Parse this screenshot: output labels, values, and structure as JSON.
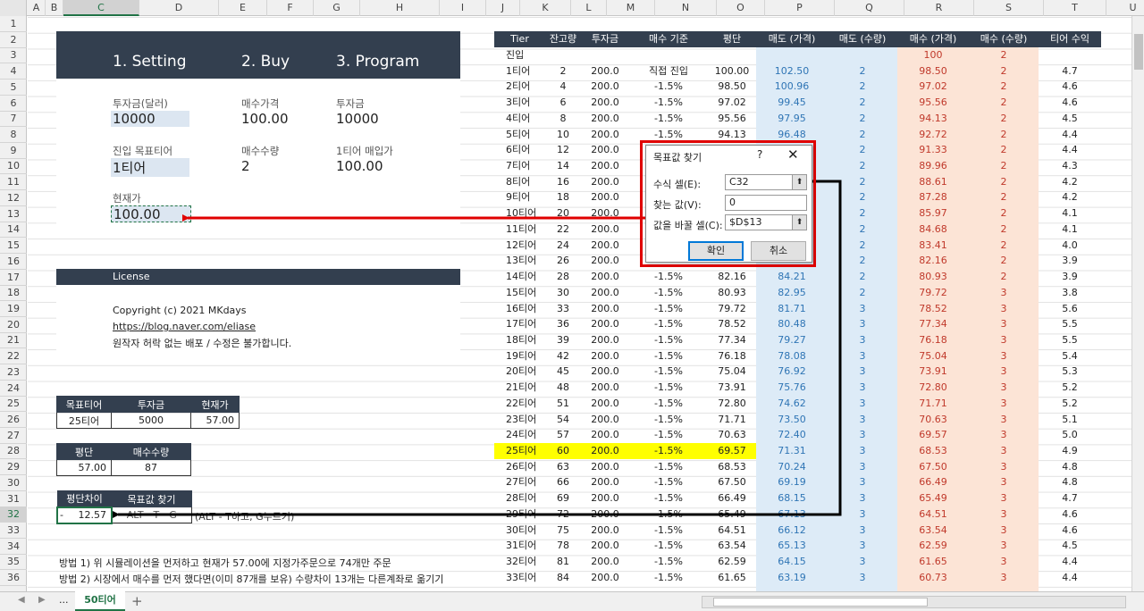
{
  "columns": [
    "A",
    "B",
    "C",
    "D",
    "E",
    "F",
    "G",
    "H",
    "I",
    "J",
    "K",
    "L",
    "M",
    "N",
    "O",
    "P",
    "Q",
    "R",
    "S",
    "T",
    "U"
  ],
  "selected_column": "C",
  "rows": [
    "1",
    "2",
    "3",
    "4",
    "5",
    "6",
    "7",
    "8",
    "9",
    "10",
    "11",
    "12",
    "13",
    "14",
    "15",
    "16",
    "17",
    "18",
    "19",
    "20",
    "21",
    "22",
    "23",
    "24",
    "25",
    "26",
    "27",
    "28",
    "29",
    "30",
    "31",
    "32",
    "33",
    "34",
    "35",
    "36"
  ],
  "selected_row": "32",
  "menu": {
    "setting": "1. Setting",
    "buy": "2. Buy",
    "program": "3. Program"
  },
  "settings": {
    "invest_label": "투자금(달러)",
    "invest_value": "10000",
    "buy_price_label": "매수가격",
    "buy_price_value": "100.00",
    "invest2_label": "투자금",
    "invest2_value": "10000",
    "target_tier_label": "진입 목표티어",
    "target_tier_value": "1티어",
    "buy_qty_label": "매수수량",
    "buy_qty_value": "2",
    "tier1_cost_label": "1티어 매입가",
    "tier1_cost_value": "100.00",
    "current_price_label": "현재가",
    "current_price_value": "100.00"
  },
  "license": {
    "title": "License",
    "copyright": "Copyright (c) 2021 MKdays",
    "link": "https://blog.naver.com/eliase",
    "notice": "원작자 허락 없는 배포 / 수정은 불가합니다."
  },
  "table1": {
    "h1": "목표티어",
    "h2": "투자금",
    "h3": "현재가",
    "v1": "25티어",
    "v2": "5000",
    "v3": "57.00"
  },
  "table2": {
    "h1": "평단",
    "h2": "매수수량",
    "v1": "57.00",
    "v2": "87"
  },
  "table3": {
    "h1": "평단차이",
    "h2": "목표값 찾기",
    "v1_prefix": "-",
    "v1": "12.57",
    "v2": "ALT - T - G",
    "hint": "(ALT - T하고, G누르기)"
  },
  "methods": {
    "m1": "방법 1) 위 시뮬레이션을 먼저하고 현재가 57.00에 지정가주문으로 74개만 주문",
    "m2": "방법 2) 시장에서 매수를 먼저 했다면(이미 87개를 보유) 수량차이 13개는 다른계좌로 옮기기"
  },
  "right_headers": [
    "Tier",
    "잔고량",
    "투자금",
    "매수 기준",
    "평단",
    "매도 (가격)",
    "매도 (수량)",
    "매수 (가격)",
    "매수 (수량)",
    "티어 수익"
  ],
  "entry_row": {
    "tier": "진입",
    "buy_price": "100",
    "buy_qty": "2"
  },
  "right_rows": [
    [
      "1티어",
      "2",
      "200.0",
      "직접 진입",
      "100.00",
      "102.50",
      "2",
      "98.50",
      "2",
      "4.7"
    ],
    [
      "2티어",
      "4",
      "200.0",
      "-1.5%",
      "98.50",
      "100.96",
      "2",
      "97.02",
      "2",
      "4.6"
    ],
    [
      "3티어",
      "6",
      "200.0",
      "-1.5%",
      "97.02",
      "99.45",
      "2",
      "95.56",
      "2",
      "4.6"
    ],
    [
      "4티어",
      "8",
      "200.0",
      "-1.5%",
      "95.56",
      "97.95",
      "2",
      "94.13",
      "2",
      "4.5"
    ],
    [
      "5티어",
      "10",
      "200.0",
      "-1.5%",
      "94.13",
      "96.48",
      "2",
      "92.72",
      "2",
      "4.4"
    ],
    [
      "6티어",
      "12",
      "200.0",
      "",
      "",
      "",
      "2",
      "91.33",
      "2",
      "4.4"
    ],
    [
      "7티어",
      "14",
      "200.0",
      "",
      "",
      "",
      "2",
      "89.96",
      "2",
      "4.3"
    ],
    [
      "8티어",
      "16",
      "200.0",
      "",
      "",
      "",
      "2",
      "88.61",
      "2",
      "4.2"
    ],
    [
      "9티어",
      "18",
      "200.0",
      "",
      "",
      "",
      "2",
      "87.28",
      "2",
      "4.2"
    ],
    [
      "10티어",
      "20",
      "200.0",
      "",
      "",
      "",
      "2",
      "85.97",
      "2",
      "4.1"
    ],
    [
      "11티어",
      "22",
      "200.0",
      "",
      "",
      "",
      "2",
      "84.68",
      "2",
      "4.1"
    ],
    [
      "12티어",
      "24",
      "200.0",
      "",
      "",
      "",
      "2",
      "83.41",
      "2",
      "4.0"
    ],
    [
      "13티어",
      "26",
      "200.0",
      "",
      "",
      "",
      "2",
      "82.16",
      "2",
      "3.9"
    ],
    [
      "14티어",
      "28",
      "200.0",
      "-1.5%",
      "82.16",
      "84.21",
      "2",
      "80.93",
      "2",
      "3.9"
    ],
    [
      "15티어",
      "30",
      "200.0",
      "-1.5%",
      "80.93",
      "82.95",
      "2",
      "79.72",
      "3",
      "3.8"
    ],
    [
      "16티어",
      "33",
      "200.0",
      "-1.5%",
      "79.72",
      "81.71",
      "3",
      "78.52",
      "3",
      "5.6"
    ],
    [
      "17티어",
      "36",
      "200.0",
      "-1.5%",
      "78.52",
      "80.48",
      "3",
      "77.34",
      "3",
      "5.5"
    ],
    [
      "18티어",
      "39",
      "200.0",
      "-1.5%",
      "77.34",
      "79.27",
      "3",
      "76.18",
      "3",
      "5.5"
    ],
    [
      "19티어",
      "42",
      "200.0",
      "-1.5%",
      "76.18",
      "78.08",
      "3",
      "75.04",
      "3",
      "5.4"
    ],
    [
      "20티어",
      "45",
      "200.0",
      "-1.5%",
      "75.04",
      "76.92",
      "3",
      "73.91",
      "3",
      "5.3"
    ],
    [
      "21티어",
      "48",
      "200.0",
      "-1.5%",
      "73.91",
      "75.76",
      "3",
      "72.80",
      "3",
      "5.2"
    ],
    [
      "22티어",
      "51",
      "200.0",
      "-1.5%",
      "72.80",
      "74.62",
      "3",
      "71.71",
      "3",
      "5.2"
    ],
    [
      "23티어",
      "54",
      "200.0",
      "-1.5%",
      "71.71",
      "73.50",
      "3",
      "70.63",
      "3",
      "5.1"
    ],
    [
      "24티어",
      "57",
      "200.0",
      "-1.5%",
      "70.63",
      "72.40",
      "3",
      "69.57",
      "3",
      "5.0"
    ],
    [
      "25티어",
      "60",
      "200.0",
      "-1.5%",
      "69.57",
      "71.31",
      "3",
      "68.53",
      "3",
      "4.9"
    ],
    [
      "26티어",
      "63",
      "200.0",
      "-1.5%",
      "68.53",
      "70.24",
      "3",
      "67.50",
      "3",
      "4.8"
    ],
    [
      "27티어",
      "66",
      "200.0",
      "-1.5%",
      "67.50",
      "69.19",
      "3",
      "66.49",
      "3",
      "4.8"
    ],
    [
      "28티어",
      "69",
      "200.0",
      "-1.5%",
      "66.49",
      "68.15",
      "3",
      "65.49",
      "3",
      "4.7"
    ],
    [
      "29티어",
      "72",
      "200.0",
      "-1.5%",
      "65.49",
      "67.13",
      "3",
      "64.51",
      "3",
      "4.6"
    ],
    [
      "30티어",
      "75",
      "200.0",
      "-1.5%",
      "64.51",
      "66.12",
      "3",
      "63.54",
      "3",
      "4.6"
    ],
    [
      "31티어",
      "78",
      "200.0",
      "-1.5%",
      "63.54",
      "65.13",
      "3",
      "62.59",
      "3",
      "4.5"
    ],
    [
      "32티어",
      "81",
      "200.0",
      "-1.5%",
      "62.59",
      "64.15",
      "3",
      "61.65",
      "3",
      "4.4"
    ],
    [
      "33티어",
      "84",
      "200.0",
      "-1.5%",
      "61.65",
      "63.19",
      "3",
      "60.73",
      "3",
      "4.4"
    ]
  ],
  "highlight_tier": "25티어",
  "dialog": {
    "title": "목표값 찾기",
    "help": "?",
    "close": "✕",
    "set_cell_label": "수식 셀(E):",
    "set_cell_value": "C32",
    "to_value_label": "찾는 값(V):",
    "to_value_value": "0",
    "changing_label": "값을 바꿀 셀(C):",
    "changing_value": "$D$13",
    "ok": "확인",
    "cancel": "취소"
  },
  "sheet_tab": "50티어",
  "nav_ellipsis": "...",
  "add_sheet": "+",
  "colors": {
    "dark": "#333f4f",
    "input_bg": "#dce6f1",
    "sell_bg": "#ddebf7",
    "buy_bg": "#fce4d6",
    "highlight": "#ffff00",
    "arrow_red": "#e00000"
  }
}
